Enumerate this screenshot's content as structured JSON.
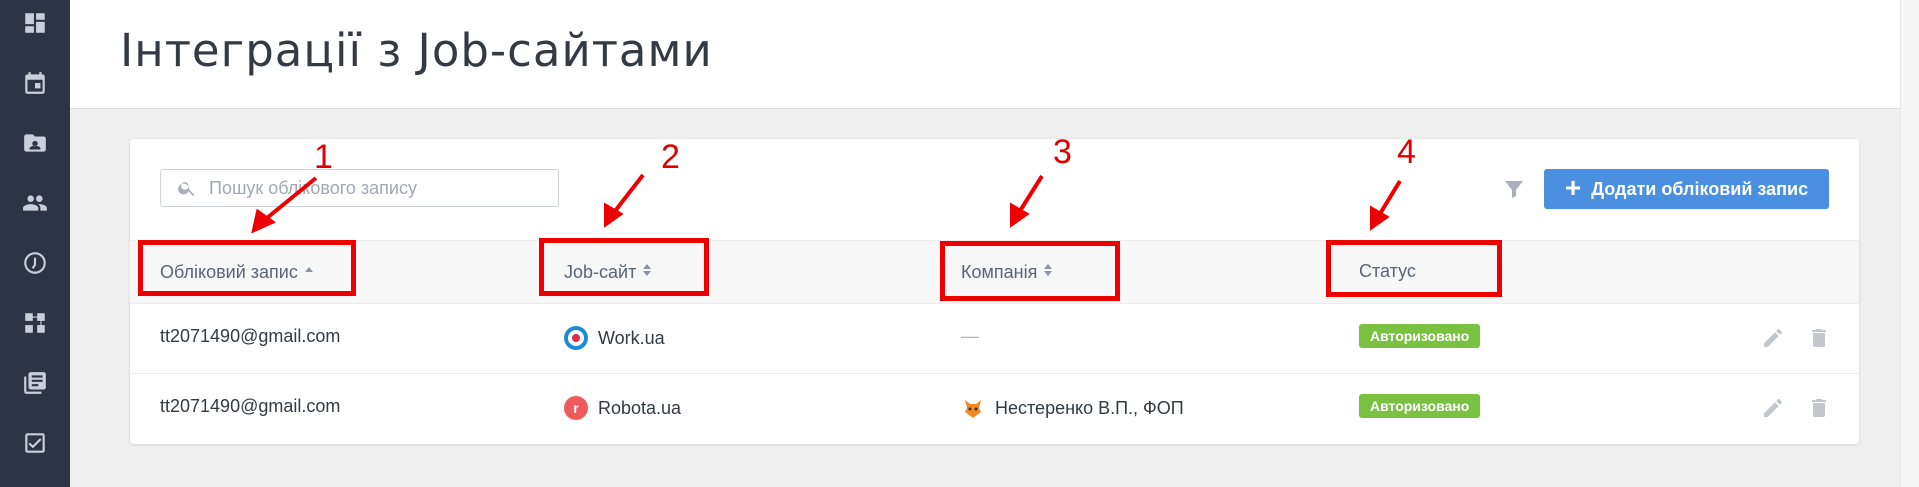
{
  "page": {
    "title": "Інтеграції з Job-сайтами"
  },
  "sidebar": {
    "items": [
      {
        "icon": "dashboard-icon"
      },
      {
        "icon": "calendar-icon"
      },
      {
        "icon": "contact-folder-icon"
      },
      {
        "icon": "people-icon"
      },
      {
        "icon": "gauge-icon"
      },
      {
        "icon": "workflow-icon"
      },
      {
        "icon": "library-icon"
      },
      {
        "icon": "task-check-icon"
      }
    ]
  },
  "toolbar": {
    "search_placeholder": "Пошук облікового запису",
    "add_button_label": "Додати обліковий запис"
  },
  "table": {
    "columns": [
      "Обліковий запис",
      "Job-сайт",
      "Компанія",
      "Статус"
    ],
    "rows": [
      {
        "account": "tt2071490@gmail.com",
        "site": "Work.ua",
        "company": "—",
        "status": "Авторизовано"
      },
      {
        "account": "tt2071490@gmail.com",
        "site": "Robota.ua",
        "company": "Нестеренко В.П., ФОП",
        "status": "Авторизовано"
      }
    ]
  },
  "annotations": [
    "1",
    "2",
    "3",
    "4"
  ],
  "colors": {
    "sidebar": "#2d3446",
    "primary": "#4a8fe0",
    "status_ok": "#7ac142",
    "annotation": "#ee0000"
  }
}
